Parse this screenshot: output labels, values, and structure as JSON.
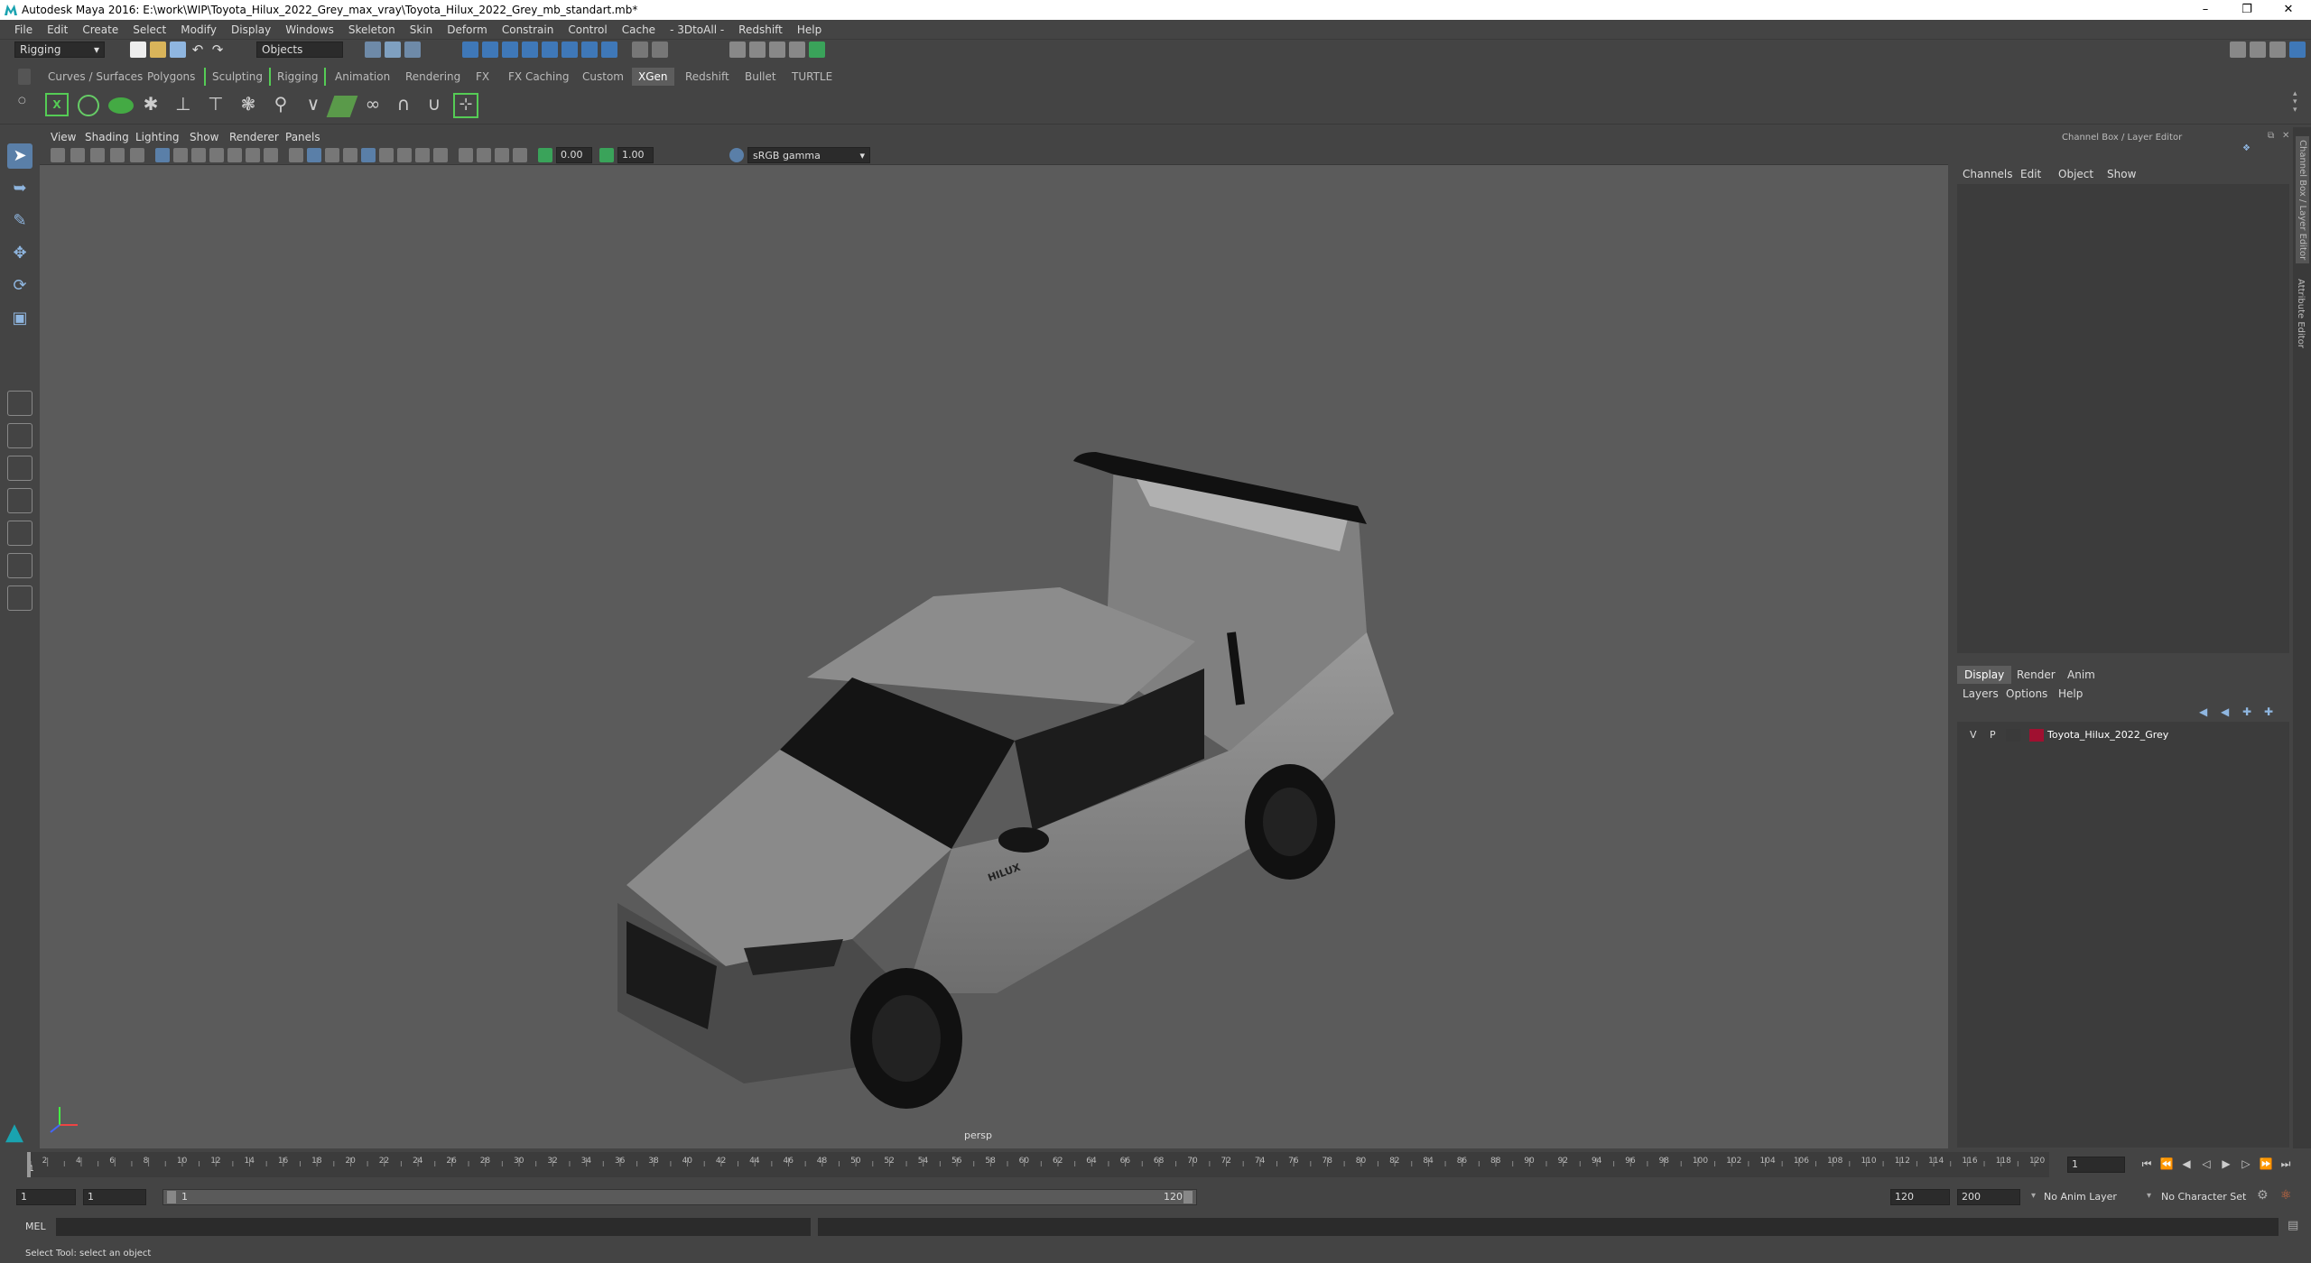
{
  "window": {
    "title": "Autodesk Maya 2016: E:\\work\\WIP\\Toyota_Hilux_2022_Grey_max_vray\\Toyota_Hilux_2022_Grey_mb_standart.mb*"
  },
  "menu": [
    "File",
    "Edit",
    "Create",
    "Select",
    "Modify",
    "Display",
    "Windows",
    "Skeleton",
    "Skin",
    "Deform",
    "Constrain",
    "Control",
    "Cache",
    "- 3DtoAll -",
    "Redshift",
    "Help"
  ],
  "status": {
    "mode": "Rigging",
    "selection_mode": "Objects"
  },
  "shelf_tabs": [
    "Curves / Surfaces",
    "Polygons",
    "Sculpting",
    "Rigging",
    "Animation",
    "Rendering",
    "FX",
    "FX Caching",
    "Custom",
    "XGen",
    "Redshift",
    "Bullet",
    "TURTLE"
  ],
  "shelf_active": "XGen",
  "viewport": {
    "menu": [
      "View",
      "Shading",
      "Lighting",
      "Show",
      "Renderer",
      "Panels"
    ],
    "exposure": "0.00",
    "gamma": "1.00",
    "color_space": "sRGB gamma",
    "camera_label": "persp",
    "car_badge": "HILUX"
  },
  "channel_box": {
    "header": "Channel Box / Layer Editor",
    "menu": [
      "Channels",
      "Edit",
      "Object",
      "Show"
    ]
  },
  "layer_editor": {
    "tabs": [
      "Display",
      "Render",
      "Anim"
    ],
    "active_tab": "Display",
    "menu": [
      "Layers",
      "Options",
      "Help"
    ],
    "layers": [
      {
        "v": "V",
        "p": "P",
        "color": "#a01030",
        "name": "Toyota_Hilux_2022_Grey"
      }
    ]
  },
  "side_tabs": [
    "Channel Box / Layer Editor",
    "Attribute Editor"
  ],
  "timeline": {
    "ticks": [
      "2",
      "4",
      "6",
      "8",
      "10",
      "12",
      "14",
      "16",
      "18",
      "20",
      "22",
      "24",
      "26",
      "28",
      "30",
      "32",
      "34",
      "36",
      "38",
      "40",
      "42",
      "44",
      "46",
      "48",
      "50",
      "52",
      "54",
      "56",
      "58",
      "60",
      "62",
      "64",
      "66",
      "68",
      "70",
      "72",
      "74",
      "76",
      "78",
      "80",
      "82",
      "84",
      "86",
      "88",
      "90",
      "92",
      "94",
      "96",
      "98",
      "100",
      "102",
      "104",
      "106",
      "108",
      "110",
      "112",
      "114",
      "116",
      "118",
      "120"
    ],
    "start_tick": "1",
    "current_frame": "1"
  },
  "range": {
    "start": "1",
    "playback_start": "1",
    "range_start_label": "1",
    "range_end_label": "120",
    "playback_end": "120",
    "end": "200",
    "anim_layer": "No Anim Layer",
    "character_set": "No Character Set"
  },
  "command_line": {
    "label": "MEL"
  },
  "help_line": "Select Tool: select an object"
}
